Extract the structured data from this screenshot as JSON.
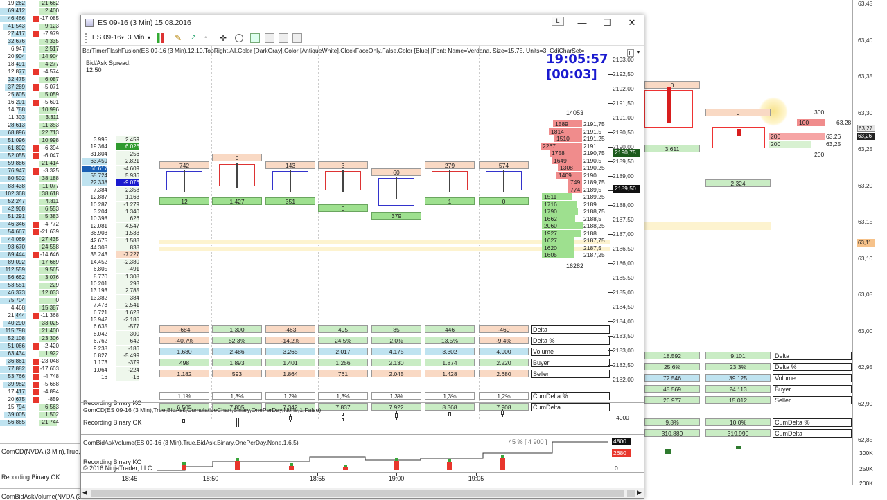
{
  "colors": {
    "red": "#e8362c",
    "green": "#2e9a2e",
    "blue": "#1a1acf",
    "pink": "#f9d9c4",
    "lightgreen": "#c9ecc4"
  },
  "window": {
    "title": "ES 09-16 (3 Min)  15.08.2016",
    "instrument": "ES 09-16",
    "interval": "3 Min",
    "L_button": "L",
    "minimize": "—",
    "maximize": "☐",
    "close": "✕"
  },
  "indicator_line": "BarTimerFlashFusion(ES 09-16 (3 Min),12,10,TopRight,All,Color [DarkGray],Color [AntiqueWhite],ClockFaceOnly,False,Color [Blue],[Font: Name=Verdana, Size=15,75, Units=3, GdiCharSet=",
  "spread": {
    "label": "Bid/Ask Spread:",
    "value": "12,50"
  },
  "clock": {
    "time": "19:05:57",
    "remaining": "[00:03]"
  },
  "dom": {
    "top_total": "14053",
    "bottom_total": "16282",
    "asks": [
      [
        "1589",
        "2191,75"
      ],
      [
        "1814",
        "2191,5"
      ],
      [
        "1510",
        "2191,25"
      ],
      [
        "2267",
        "2191"
      ],
      [
        "1758",
        "2190,75"
      ],
      [
        "1649",
        "2190,5"
      ],
      [
        "1308",
        "2190,25"
      ],
      [
        "1409",
        "2190"
      ],
      [
        "749",
        "2189,75"
      ],
      [
        "774",
        "2189,5"
      ]
    ],
    "bids": [
      [
        "1511",
        "2189,25"
      ],
      [
        "1716",
        "2189"
      ],
      [
        "1790",
        "2188,75"
      ],
      [
        "1662",
        "2188,5"
      ],
      [
        "2060",
        "2188,25"
      ],
      [
        "1927",
        "2188"
      ],
      [
        "1627",
        "2187,75"
      ],
      [
        "1620",
        "2187,5"
      ],
      [
        "1605",
        "2187,25"
      ]
    ]
  },
  "price_axis": [
    "2193,00",
    "2192,50",
    "2192,00",
    "2191,50",
    "2191,00",
    "2190,50",
    "2190,00",
    "2189,50",
    "2189,00",
    "2188,50",
    "2188,00",
    "2187,50",
    "2187,00",
    "2186,50",
    "2186,00",
    "2185,50",
    "2185,00",
    "2184,50",
    "2184,00",
    "2183,50",
    "2183,00",
    "2182,50",
    "2182,00"
  ],
  "last_price": "2190,75",
  "bid_price": "2189,50",
  "top_boxes": [
    "742",
    "0",
    "143",
    "3",
    "60",
    "279",
    "574"
  ],
  "mid_green": [
    "12",
    "1.427",
    "351",
    "0",
    "379",
    "1",
    "0"
  ],
  "stats": {
    "labels": [
      "Delta",
      "Delta %",
      "Volume",
      "Buyer",
      "Seller"
    ],
    "delta": [
      "-684",
      "1.300",
      "-463",
      "495",
      "85",
      "446",
      "-460"
    ],
    "delta_pct": [
      "-40,7%",
      "52,3%",
      "-14,2%",
      "24,5%",
      "2,0%",
      "13,5%",
      "-9,4%"
    ],
    "volume": [
      "1.680",
      "2.486",
      "3.265",
      "2.017",
      "4.175",
      "3.302",
      "4.900"
    ],
    "buyer": [
      "498",
      "1.893",
      "1.401",
      "1.256",
      "2.130",
      "1.874",
      "2.220"
    ],
    "seller": [
      "1.182",
      "593",
      "1.864",
      "761",
      "2.045",
      "1.428",
      "2.680"
    ]
  },
  "cum": {
    "labels": [
      "CumDelta %",
      "CumDelta"
    ],
    "pct": [
      "1,1%",
      "1,3%",
      "1,2%",
      "1,3%",
      "1,3%",
      "1,3%",
      "1,2%"
    ],
    "val": [
      "6.505",
      "7.805",
      "7.342",
      "7.837",
      "7.922",
      "8.368",
      "7.908"
    ]
  },
  "panel2": {
    "title": "GomCD(ES 09-16 (3 Min),True,BidAsk,CumulativeChart,Binary,OnePerDay,None,1,False)",
    "status": "Recording Binary OK",
    "axis": "4000"
  },
  "panel3": {
    "title": "GomBidAskVolume(ES 09-16 (3 Min),True,BidAsk,Binary,OnePerDay,None,1,6,5)",
    "status": "Recording Binary KO",
    "copyright": "© 2016 NinjaTrader, LLC",
    "pct_label": "45 % [ 4 900 ]",
    "v1": "4800",
    "v2": "2680",
    "v3": "0"
  },
  "recording_top": "Recording Binary KO",
  "time_axis": [
    "18:45",
    "18:50",
    "18:55",
    "19:00",
    "19:05"
  ],
  "bg": {
    "left_rows": [
      [
        "19.262",
        "21.662"
      ],
      [
        "69.412",
        "2.400"
      ],
      [
        "46.466",
        "-17.085"
      ],
      [
        "41.543",
        "9.123"
      ],
      [
        "27.417",
        "-7.979"
      ],
      [
        "32.676",
        "4.335"
      ],
      [
        "6.947",
        "2.517"
      ],
      [
        "20.904",
        "14.904"
      ],
      [
        "18.491",
        "4.277"
      ],
      [
        "12.877",
        "-4.574"
      ],
      [
        "32.475",
        "6.087"
      ],
      [
        "37.289",
        "-5.071"
      ],
      [
        "25.805",
        "5.059"
      ],
      [
        "16.201",
        "-5.601"
      ],
      [
        "14.788",
        "10.996"
      ],
      [
        "11.303",
        "3.311"
      ],
      [
        "28.613",
        "11.353"
      ],
      [
        "68.896",
        "22.713"
      ],
      [
        "51.096",
        "10.998"
      ],
      [
        "61.802",
        "-6.394"
      ],
      [
        "52.055",
        "-6.047"
      ],
      [
        "59.886",
        "21.414"
      ],
      [
        "76.947",
        "-3.325"
      ],
      [
        "80.502",
        "38.188"
      ],
      [
        "83.438",
        "11.077"
      ],
      [
        "102.368",
        "38.618"
      ],
      [
        "52.247",
        "4.811"
      ],
      [
        "42.908",
        "6.553"
      ],
      [
        "51.291",
        "5.383"
      ],
      [
        "46.346",
        "-4.772"
      ],
      [
        "54.667",
        "-21.639"
      ],
      [
        "44.069",
        "27.435"
      ],
      [
        "93.670",
        "24.558"
      ],
      [
        "89.444",
        "-14.646"
      ],
      [
        "89.092",
        "17.669"
      ],
      [
        "112.559",
        "9.565"
      ],
      [
        "56.662",
        "3.076"
      ],
      [
        "53.551",
        "229"
      ],
      [
        "46.373",
        "12.033"
      ],
      [
        "75.704",
        "0"
      ],
      [
        "4.468",
        "15.387"
      ],
      [
        "21.444",
        "-11.368"
      ],
      [
        "40.290",
        "33.025"
      ],
      [
        "115.798",
        "21.400"
      ],
      [
        "52.108",
        "23.306"
      ],
      [
        "51.066",
        "-2.420"
      ],
      [
        "63.434",
        "1.922"
      ],
      [
        "36.861",
        "-23.048"
      ],
      [
        "77.882",
        "-17.603"
      ],
      [
        "53.766",
        "-4.748"
      ],
      [
        "39.982",
        "-5.688"
      ],
      [
        "17.417",
        "-4.894"
      ],
      [
        "20.675",
        "-859"
      ],
      [
        "15.794",
        "6.563"
      ],
      [
        "39.005",
        "1.502"
      ],
      [
        "56.865",
        "21.744"
      ]
    ],
    "right_scale": [
      "63,45",
      "63,40",
      "63,35",
      "63,30",
      "63,25",
      "63,20",
      "63,15",
      "63,10",
      "63,05",
      "63,00",
      "62,95",
      "62,90",
      "62,85"
    ],
    "right_stats": {
      "labels": [
        "Delta",
        "Delta %",
        "Volume",
        "Buyer",
        "Seller",
        "CumDelta %",
        "CumDelta"
      ],
      "c1": [
        "18.592",
        "25,6%",
        "72.546",
        "45.569",
        "26.977",
        "9,8%",
        "310.889"
      ],
      "c2": [
        "9.101",
        "23,3%",
        "39.125",
        "24.113",
        "15.012",
        "10,0%",
        "319.990"
      ]
    },
    "right_top": [
      "0",
      "3.611",
      "2.324",
      "0",
      "300",
      "100",
      "63,28",
      "63,27",
      "63,26",
      "63,25",
      "200",
      "200",
      "200"
    ],
    "bottom_left": [
      "GomCD(NVDA (3 Min),True,",
      "Recording Binary OK",
      "GomBidAskVolume(NVDA (3 Min"
    ],
    "right_vol": [
      "300K",
      "250K",
      "200K"
    ],
    "price_tag": "63,11"
  }
}
